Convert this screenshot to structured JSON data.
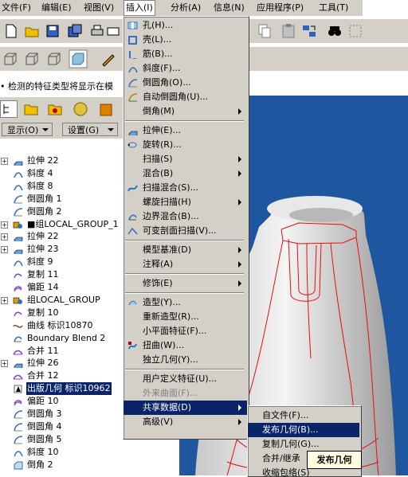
{
  "menubar": {
    "items": [
      {
        "label": "文件(F)"
      },
      {
        "label": "编辑(E)"
      },
      {
        "label": "视图(V)"
      },
      {
        "label": "插入(I)"
      },
      {
        "label": "分析(A)"
      },
      {
        "label": "信息(N)"
      },
      {
        "label": "应用程序(P)"
      },
      {
        "label": "工具(T)"
      }
    ]
  },
  "status": {
    "message": "• 检测的特征类型将显示在模"
  },
  "model_tree": {
    "show_label": "显示(O)",
    "settings_label": "设置(G)",
    "items": [
      {
        "label": "拉伸 22",
        "icon": "extrude-icon",
        "expand": true
      },
      {
        "label": "斜度 4",
        "icon": "draft-icon"
      },
      {
        "label": "斜度 8",
        "icon": "draft-icon"
      },
      {
        "label": "倒圆角 1",
        "icon": "round-icon"
      },
      {
        "label": "倒圆角 2",
        "icon": "round-icon"
      },
      {
        "label": "■组LOCAL_GROUP_1",
        "icon": "group-icon",
        "expand": true
      },
      {
        "label": "拉伸 22",
        "icon": "extrude-icon",
        "expand": true
      },
      {
        "label": "拉伸 23",
        "icon": "extrude-icon",
        "expand": true
      },
      {
        "label": "斜度 9",
        "icon": "draft-icon"
      },
      {
        "label": "复制 11",
        "icon": "copy-icon"
      },
      {
        "label": "偏距 14",
        "icon": "offset-icon"
      },
      {
        "label": "组LOCAL_GROUP",
        "icon": "group-icon",
        "expand": true
      },
      {
        "label": "复制 10",
        "icon": "copy-icon"
      },
      {
        "label": "曲线 标识10870",
        "icon": "curve-icon"
      },
      {
        "label": "Boundary Blend 2",
        "icon": "boundary-blend-icon"
      },
      {
        "label": "合并 11",
        "icon": "merge-icon"
      },
      {
        "label": "拉伸 26",
        "icon": "extrude-icon",
        "expand": true
      },
      {
        "label": "合并 12",
        "icon": "merge-icon"
      },
      {
        "label": "出版几何 标识10962",
        "icon": "publish-geom-icon",
        "selected": true
      },
      {
        "label": "偏距 10",
        "icon": "offset-icon"
      },
      {
        "label": "倒圆角 3",
        "icon": "round-icon"
      },
      {
        "label": "倒圆角 4",
        "icon": "round-icon"
      },
      {
        "label": "倒圆角 5",
        "icon": "round-icon"
      },
      {
        "label": "斜度 10",
        "icon": "draft-icon"
      },
      {
        "label": "倒角 2",
        "icon": "chamfer-icon"
      }
    ]
  },
  "insert_menu": {
    "items": [
      {
        "label": "孔(H)...",
        "icon": "hole-icon"
      },
      {
        "label": "壳(L)...",
        "icon": "shell-icon"
      },
      {
        "label": "筋(B)...",
        "icon": "rib-icon"
      },
      {
        "label": "斜度(F)...",
        "icon": "draft-icon"
      },
      {
        "label": "倒圆角(O)...",
        "icon": "round-icon"
      },
      {
        "label": "自动倒圆角(U)...",
        "icon": "auto-round-icon"
      },
      {
        "label": "倒角(M)",
        "submenu": true
      },
      {
        "sep": true
      },
      {
        "label": "拉伸(E)...",
        "icon": "extrude-icon"
      },
      {
        "label": "旋转(R)...",
        "icon": "revolve-icon"
      },
      {
        "label": "扫描(S)",
        "submenu": true
      },
      {
        "label": "混合(B)",
        "submenu": true
      },
      {
        "label": "扫描混合(S)...",
        "icon": "swept-blend-icon"
      },
      {
        "label": "螺旋扫描(H)",
        "submenu": true
      },
      {
        "label": "边界混合(B)...",
        "icon": "boundary-blend-icon"
      },
      {
        "label": "可变剖面扫描(V)...",
        "icon": "var-sweep-icon"
      },
      {
        "sep": true
      },
      {
        "label": "模型基准(D)",
        "submenu": true
      },
      {
        "label": "注释(A)",
        "submenu": true
      },
      {
        "sep": true
      },
      {
        "label": "修饰(E)",
        "submenu": true
      },
      {
        "sep": true
      },
      {
        "label": "造型(Y)...",
        "icon": "style-icon"
      },
      {
        "label": "重新造型(R)..."
      },
      {
        "label": "小平面特征(F)..."
      },
      {
        "label": "扭曲(W)...",
        "icon": "warp-icon"
      },
      {
        "label": "独立几何(Y)..."
      },
      {
        "sep": true
      },
      {
        "label": "用户定义特征(U)..."
      },
      {
        "label": "外来曲面(F)...",
        "disabled": true
      },
      {
        "label": "共享数据(D)",
        "submenu": true,
        "highlight": true
      },
      {
        "label": "高级(V)",
        "submenu": true
      }
    ]
  },
  "shared_data_submenu": {
    "items": [
      {
        "label": "自文件(F)..."
      },
      {
        "label": "发布几何(B)...",
        "highlight": true
      },
      {
        "label": "复制几何(G)..."
      },
      {
        "label": "合并/继承"
      },
      {
        "label": "收缩包络(S)"
      }
    ]
  },
  "tooltip": {
    "text": "发布几何"
  },
  "colors": {
    "menu_bg": "#d4d0c8",
    "highlight": "#0a246a",
    "viewport_bg": "#1e56a0",
    "model_edge": "#e01010"
  }
}
